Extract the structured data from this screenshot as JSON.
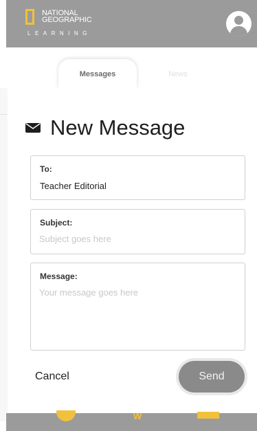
{
  "brand": {
    "line1": "NATIONAL",
    "line2": "GEOGRAPHIC",
    "subline": "LEARNING",
    "accent_color": "#f2c13b",
    "header_color": "#9b9b9b"
  },
  "header": {
    "avatar_icon": "user-avatar-icon"
  },
  "tabs": [
    {
      "label": "Messages",
      "active": true
    },
    {
      "label": "News",
      "active": false
    }
  ],
  "modal": {
    "icon": "envelope-icon",
    "title": "New Message",
    "to": {
      "label": "To:",
      "value": "Teacher Editorial"
    },
    "subject": {
      "label": "Subject:",
      "placeholder": "Subject goes here",
      "value": ""
    },
    "message": {
      "label": "Message:",
      "placeholder": "Your message goes here",
      "value": ""
    },
    "cancel_label": "Cancel",
    "send_label": "Send"
  },
  "bottom_nav": {
    "icons": [
      "home-icon",
      "w-icon",
      "folder-icon"
    ]
  }
}
